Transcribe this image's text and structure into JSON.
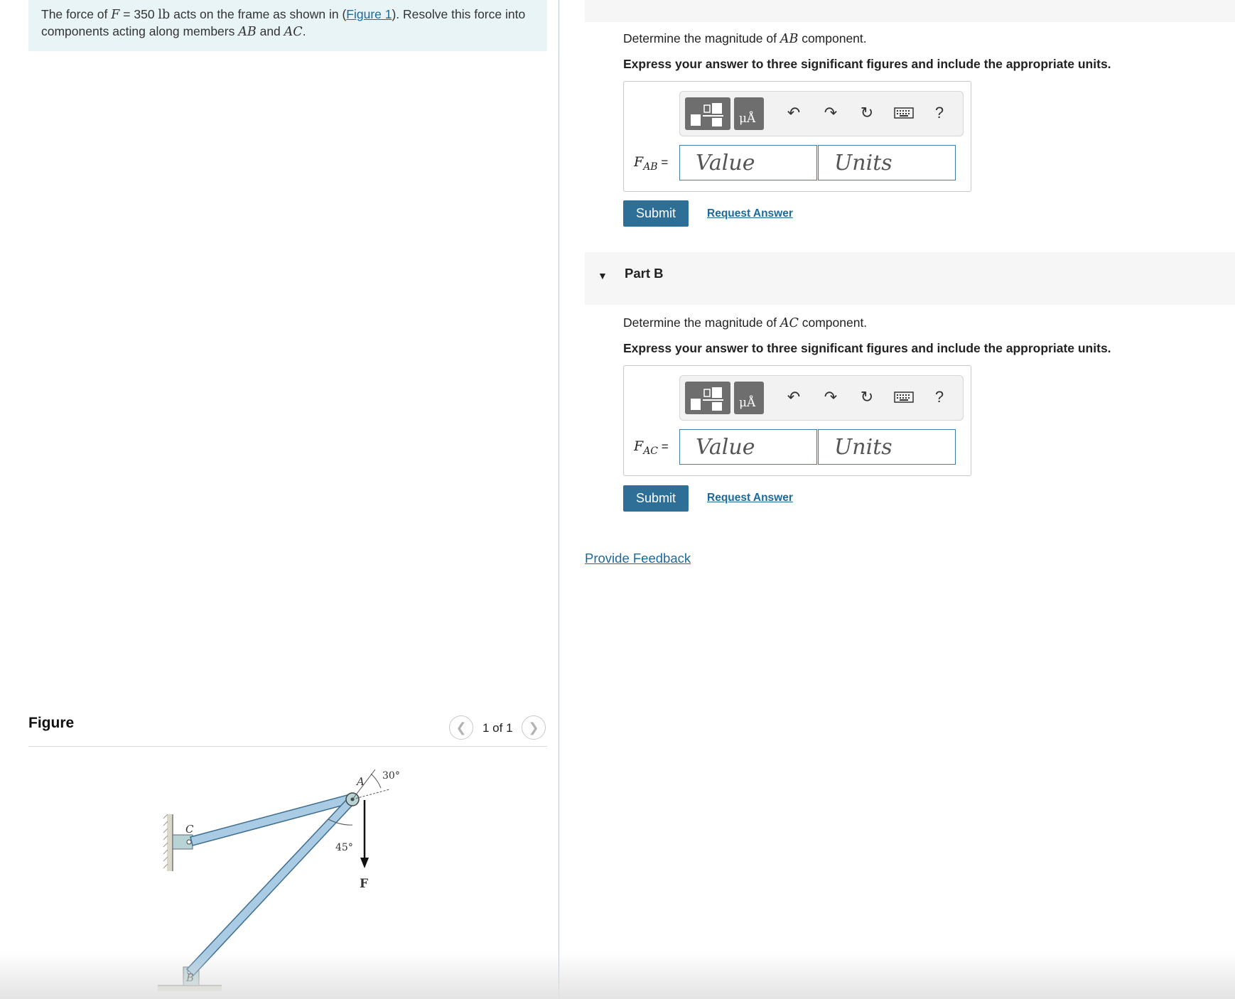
{
  "problem": {
    "t1": "The force of ",
    "force_var": "F",
    "eq": " = 350 ",
    "unit": "lb",
    "t2": " acts on the frame as shown in (",
    "figure_link": "Figure 1",
    "t3": "). Resolve this force into components acting along members ",
    "ab": "AB",
    "and": " and ",
    "ac": "AC",
    "period": "."
  },
  "figure": {
    "heading": "Figure",
    "pager_label": "1 of 1",
    "labels": {
      "a": "A",
      "b": "B",
      "c": "C",
      "f": "F",
      "angle_30": "30°",
      "angle_45": "45°"
    }
  },
  "part_a": {
    "prompt_pre": "Determine the magnitude of ",
    "member": "AB",
    "prompt_post": " component.",
    "instruction": "Express your answer to three significant figures and include the appropriate units.",
    "var": "F",
    "var_sub": "AB",
    "eq": " =",
    "value_placeholder": "Value",
    "units_placeholder": "Units",
    "submit_label": "Submit",
    "request_label": "Request Answer"
  },
  "part_b": {
    "title": "Part B",
    "prompt_pre": "Determine the magnitude of ",
    "member": "AC",
    "prompt_post": " component.",
    "instruction": "Express your answer to three significant figures and include the appropriate units.",
    "var": "F",
    "var_sub": "AC",
    "eq": " =",
    "value_placeholder": "Value",
    "units_placeholder": "Units",
    "submit_label": "Submit",
    "request_label": "Request Answer"
  },
  "toolbar": {
    "units_glyph": "μÅ",
    "help": "?",
    "icons": [
      "templates-icon",
      "units-icon",
      "undo-icon",
      "redo-icon",
      "reset-icon",
      "keyboard-icon",
      "help-icon"
    ]
  },
  "feedback_label": "Provide Feedback",
  "colors": {
    "accent": "#2d6f96",
    "link": "#1a6a9c",
    "problem_bg": "#e9f4f6",
    "member_fill": "#a9cbe3"
  }
}
